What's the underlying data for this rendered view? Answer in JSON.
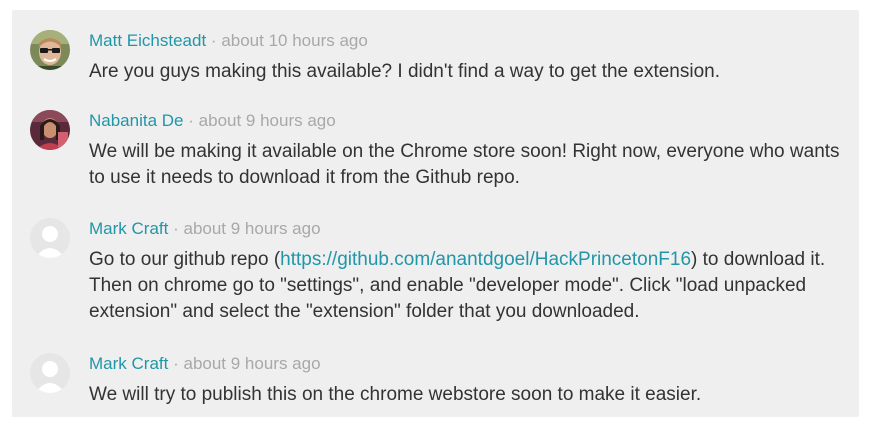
{
  "comments": [
    {
      "author": "Matt Eichsteadt",
      "time": "about 10 hours ago",
      "avatar": "photo-avatar-matt",
      "text": "Are you guys making this available? I didn't find a way to get the extension."
    },
    {
      "author": "Nabanita De",
      "time": "about 9 hours ago",
      "avatar": "photo-avatar-nabanita",
      "text": "We will be making it available on the Chrome store soon! Right now, everyone who wants to use it needs to download it from the Github repo."
    },
    {
      "author": "Mark Craft",
      "time": "about 9 hours ago",
      "avatar": "default-user-avatar",
      "text_before": "Go to our github repo (",
      "link": "https://github.com/anantdgoel/HackPrincetonF16",
      "text_after": ") to download it. Then on chrome go to \"settings\", and enable \"developer mode\". Click \"load unpacked extension\" and select the \"extension\" folder that you downloaded."
    },
    {
      "author": "Mark Craft",
      "time": "about 9 hours ago",
      "avatar": "default-user-avatar",
      "text": "We will try to publish this on the chrome webstore soon to make it easier."
    }
  ],
  "separator": "·",
  "colors": {
    "panel_bg": "#efefef",
    "author": "#2196a8",
    "link": "#2196a8",
    "meta": "#a8a8a8",
    "text": "#333333"
  }
}
